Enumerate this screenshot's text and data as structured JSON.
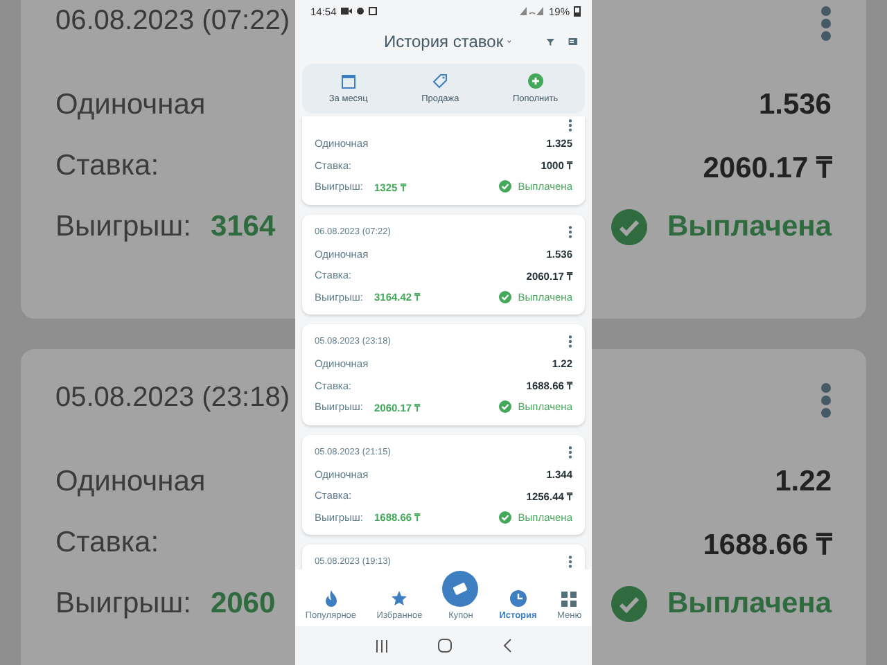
{
  "backdrop": {
    "cards": [
      {
        "date": "06.08.2023 (07:22)",
        "type": "Одиночная",
        "odds": "1.536",
        "stake_label": "Ставка:",
        "stake": "2060.17 ₸",
        "win_label": "Выигрыш:",
        "win": "3164",
        "status": "Выплачена"
      },
      {
        "date": "05.08.2023 (23:18)",
        "type": "Одиночная",
        "odds": "1.22",
        "stake_label": "Ставка:",
        "stake": "1688.66 ₸",
        "win_label": "Выигрыш:",
        "win": "2060",
        "status": "Выплачена"
      }
    ]
  },
  "status_bar": {
    "time": "14:54",
    "battery": "19%"
  },
  "header": {
    "title": "История ставок"
  },
  "actions": [
    {
      "kind": "calendar",
      "label": "За месяц"
    },
    {
      "kind": "tag",
      "label": "Продажа"
    },
    {
      "kind": "plus",
      "label": "Пополнить"
    }
  ],
  "bets": [
    {
      "type": "Одиночная",
      "odds": "1.325",
      "stake_label": "Ставка:",
      "stake": "1000 ₸",
      "win_label": "Выигрыш:",
      "win": "1325 ₸",
      "status": "Выплачена"
    },
    {
      "date": "06.08.2023 (07:22)",
      "type": "Одиночная",
      "odds": "1.536",
      "stake_label": "Ставка:",
      "stake": "2060.17 ₸",
      "win_label": "Выигрыш:",
      "win": "3164.42 ₸",
      "status": "Выплачена"
    },
    {
      "date": "05.08.2023 (23:18)",
      "type": "Одиночная",
      "odds": "1.22",
      "stake_label": "Ставка:",
      "stake": "1688.66 ₸",
      "win_label": "Выигрыш:",
      "win": "2060.17 ₸",
      "status": "Выплачена"
    },
    {
      "date": "05.08.2023 (21:15)",
      "type": "Одиночная",
      "odds": "1.344",
      "stake_label": "Ставка:",
      "stake": "1256.44 ₸",
      "win_label": "Выигрыш:",
      "win": "1688.66 ₸",
      "status": "Выплачена"
    },
    {
      "date": "05.08.2023 (19:13)"
    }
  ],
  "nav": [
    {
      "kind": "fire",
      "label": "Популярное",
      "selected": false
    },
    {
      "kind": "star",
      "label": "Избранное",
      "selected": false
    },
    {
      "kind": "fab",
      "label": "Купон",
      "selected": false
    },
    {
      "kind": "clock",
      "label": "История",
      "selected": true
    },
    {
      "kind": "grid",
      "label": "Меню",
      "selected": false
    }
  ]
}
